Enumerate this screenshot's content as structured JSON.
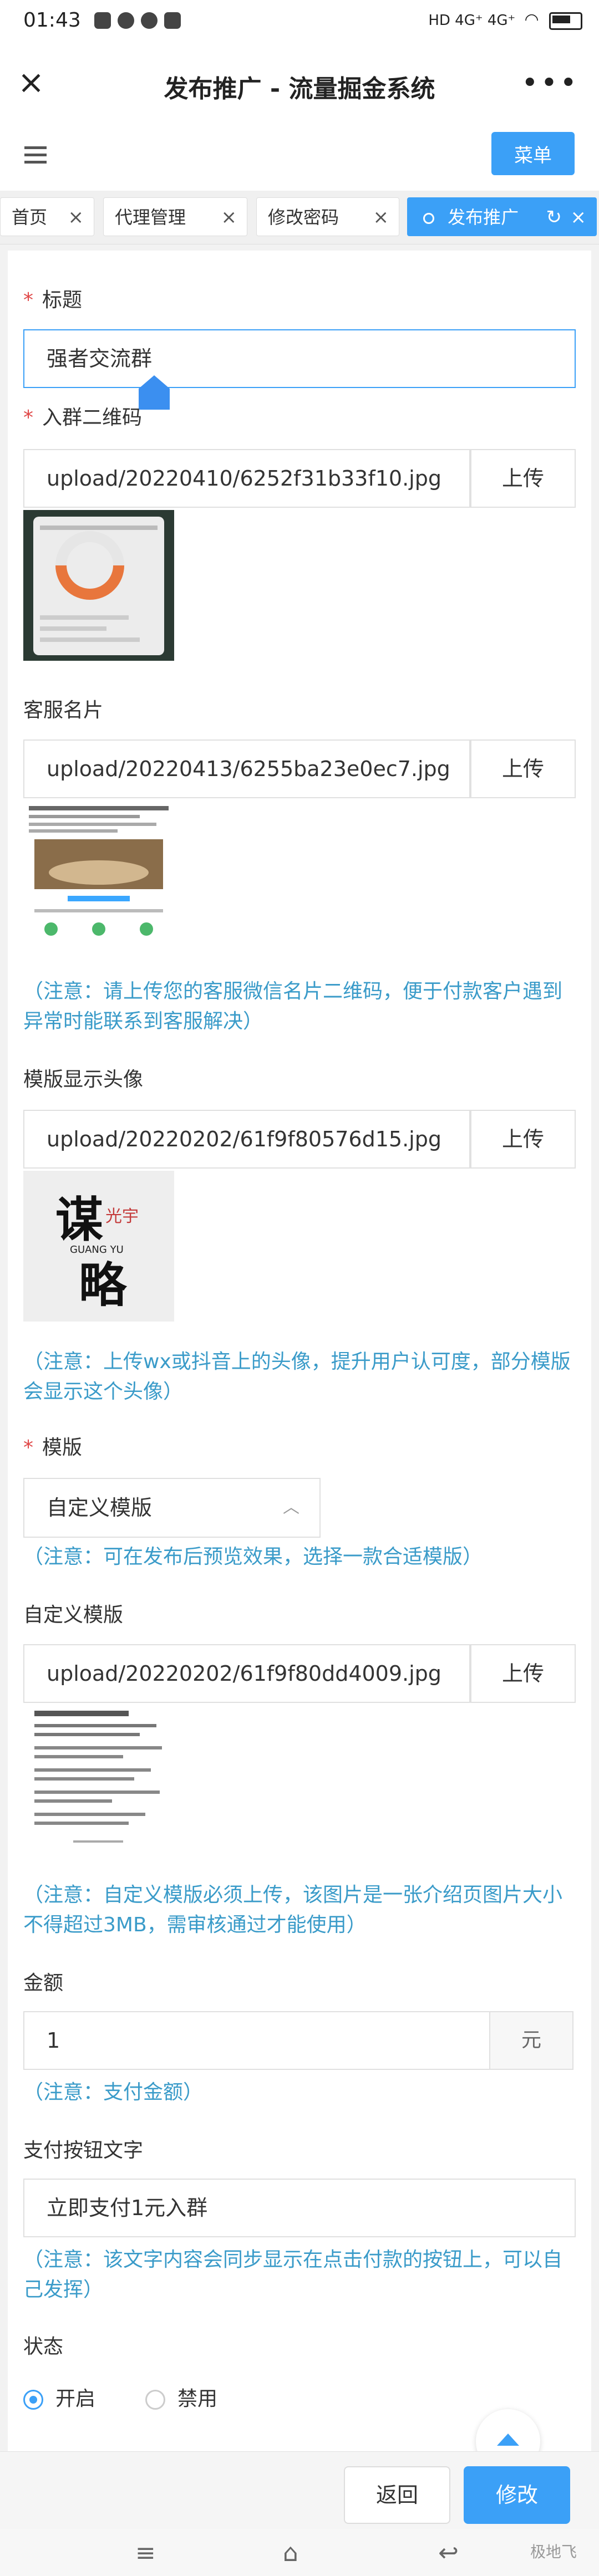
{
  "status_bar": {
    "time": "01:43",
    "network": "HD 4G⁺ 4G⁺"
  },
  "title_bar": {
    "title": "发布推广 - 流量掘金系统",
    "more": "•••"
  },
  "toolbar": {
    "menu_label": "菜单"
  },
  "tabs": [
    {
      "label": "首页"
    },
    {
      "label": "代理管理"
    },
    {
      "label": "修改密码"
    },
    {
      "label": "发布推广"
    }
  ],
  "form": {
    "title_label": "标题",
    "title_value": "强者交流群",
    "qrcode_label": "入群二维码",
    "qrcode_path": "upload/20220410/6252f31b33f10.jpg",
    "upload_label": "上传",
    "service_label": "客服名片",
    "service_path": "upload/20220413/6255ba23e0ec7.jpg",
    "service_note": "（注意：请上传您的客服微信名片二维码，便于付款客户遇到异常时能联系到客服解决）",
    "avatar_label": "模版显示头像",
    "avatar_path": "upload/20220202/61f9f80576d15.jpg",
    "avatar_note": "（注意：上传wx或抖音上的头像，提升用户认可度，部分模版会显示这个头像）",
    "avatar_text": {
      "c1": "谋",
      "c2": "略",
      "sub": "GUANG YU",
      "seal": "光宇"
    },
    "template_label": "模版",
    "template_value": "自定义模版",
    "template_note": "（注意：可在发布后预览效果，选择一款合适模版）",
    "custom_label": "自定义模版",
    "custom_path": "upload/20220202/61f9f80dd4009.jpg",
    "custom_note": "（注意：自定义模版必须上传，该图片是一张介绍页图片大小不得超过3MB，需审核通过才能使用）",
    "amount_label": "金额",
    "amount_value": "1",
    "amount_unit": "元",
    "amount_note": "（注意：支付金额）",
    "paybtn_label": "支付按钮文字",
    "paybtn_value": "立即支付1元入群",
    "paybtn_note": "（注意：该文字内容会同步显示在点击付款的按钮上，可以自己发挥）",
    "status_label": "状态",
    "status_on": "开启",
    "status_off": "禁用"
  },
  "footer": {
    "back_label": "返回",
    "submit_label": "修改"
  },
  "watermark": "极地飞"
}
